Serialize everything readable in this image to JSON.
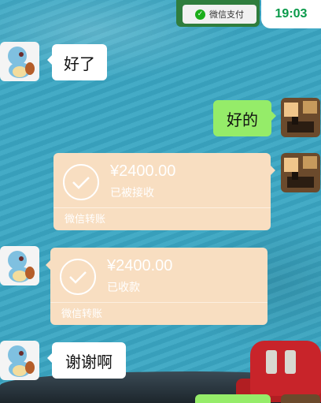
{
  "status_bar": {
    "time": "19:03"
  },
  "top_pay_button": {
    "label": "微信支付",
    "icon": "wechat-pay-icon"
  },
  "messages": [
    {
      "side": "left",
      "type": "text",
      "text": "好了"
    },
    {
      "side": "right",
      "type": "text",
      "text": "好的"
    },
    {
      "side": "right",
      "type": "transfer",
      "amount": "¥2400.00",
      "status": "已被接收",
      "footer": "微信转账"
    },
    {
      "side": "left",
      "type": "transfer",
      "amount": "¥2400.00",
      "status": "已收款",
      "footer": "微信转账"
    },
    {
      "side": "left",
      "type": "text",
      "text": "谢谢啊"
    }
  ],
  "colors": {
    "chat_background": "#3aa6c3",
    "right_bubble": "#95ec69",
    "transfer_card": "#f8dec1",
    "time_text": "#0a9a4a"
  }
}
